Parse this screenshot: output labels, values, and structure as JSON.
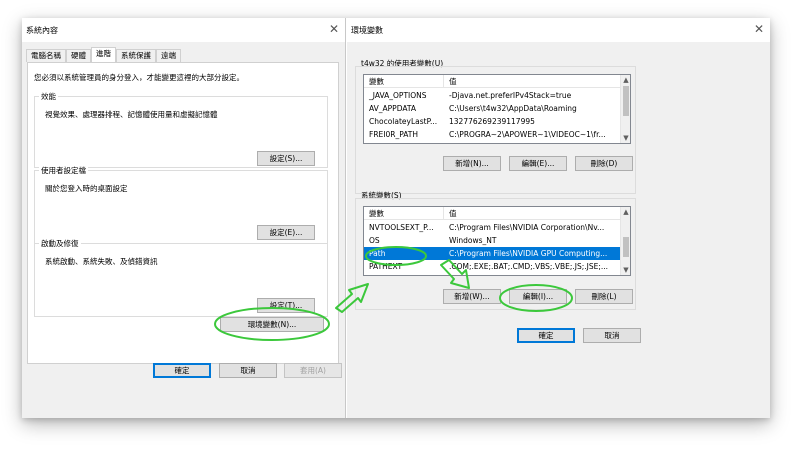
{
  "left_window": {
    "title": "系統內容",
    "tabs": [
      "電腦名稱",
      "硬體",
      "進階",
      "系統保護",
      "遠端"
    ],
    "active_tab": 2,
    "intro": "您必須以系統管理員的身分登入，才能變更這裡的大部分設定。",
    "groups": [
      {
        "title": "效能",
        "desc": "視覺效果、處理器排程、記憶體使用量和虛擬記憶體",
        "button": "設定(S)..."
      },
      {
        "title": "使用者設定檔",
        "desc": "關於您登入時的桌面設定",
        "button": "設定(E)..."
      },
      {
        "title": "啟動及修復",
        "desc": "系統啟動、系統失敗、及偵錯資訊",
        "button": "設定(T)..."
      }
    ],
    "env_button": "環境變數(N)...",
    "ok": "確定",
    "cancel": "取消",
    "apply": "套用(A)"
  },
  "right_window": {
    "title": "環境變數",
    "user_section": "t4w32 的使用者變數(U)",
    "columns": [
      "變數",
      "值"
    ],
    "user_vars": [
      {
        "name": "_JAVA_OPTIONS",
        "value": "-Djava.net.preferIPv4Stack=true"
      },
      {
        "name": "AV_APPDATA",
        "value": "C:\\Users\\t4w32\\AppData\\Roaming"
      },
      {
        "name": "ChocolateyLastP...",
        "value": "132776269239117995"
      },
      {
        "name": "FREI0R_PATH",
        "value": "C:\\PROGRA~2\\APOWER~1\\VIDEOC~1\\fr..."
      }
    ],
    "user_buttons": {
      "new": "新增(N)...",
      "edit": "編輯(E)...",
      "delete": "刪除(D)"
    },
    "system_section": "系統變數(S)",
    "system_vars": [
      {
        "name": "NVTOOLSEXT_P...",
        "value": "C:\\Program Files\\NVIDIA Corporation\\Nv..."
      },
      {
        "name": "OS",
        "value": "Windows_NT"
      },
      {
        "name": "Path",
        "value": "C:\\Program Files\\NVIDIA GPU Computing..."
      },
      {
        "name": "PATHEXT",
        "value": ".COM;.EXE;.BAT;.CMD;.VBS;.VBE;.JS;.JSE;..."
      }
    ],
    "selected_system_index": 2,
    "system_buttons": {
      "new": "新增(W)...",
      "edit": "編輯(I)...",
      "delete": "刪除(L)"
    },
    "ok": "確定",
    "cancel": "取消"
  },
  "annotation_color": "#3cc83c",
  "selection_color": "#0078d7"
}
